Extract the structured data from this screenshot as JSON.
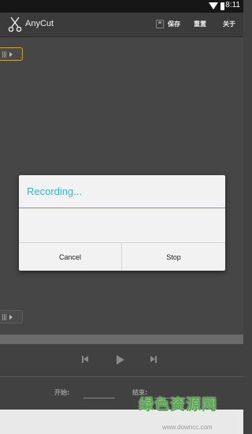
{
  "status_bar": {
    "time": "8:11",
    "icons": [
      "wifi-icon",
      "battery-icon"
    ]
  },
  "action_bar": {
    "title": "AnyCut",
    "icon": "scissors-icon",
    "save_icon": "save-icon",
    "save_label": "保存",
    "reset_label": "重置",
    "about_label": "关于"
  },
  "dialog": {
    "title": "Recording...",
    "cancel_label": "Cancel",
    "stop_label": "Stop",
    "accent_color": "#35b6d3"
  },
  "playback": {
    "icons": [
      "previous-icon",
      "play-icon",
      "next-icon"
    ]
  },
  "time_fields": {
    "start_label": "开始:",
    "end_label": "结束:"
  },
  "watermark": {
    "text": "绿色资源网",
    "url": "www.downcc.com"
  }
}
